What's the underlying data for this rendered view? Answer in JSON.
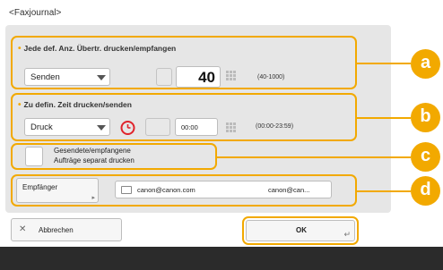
{
  "screen_title": "<Faxjournal>",
  "section_a": {
    "label": "Jede def. Anz. Übertr. drucken/empfangen",
    "dropdown_value": "Senden",
    "count_value": "40",
    "range_hint": "(40-1000)"
  },
  "section_b": {
    "label": "Zu defin. Zeit drucken/senden",
    "dropdown_value": "Druck",
    "time_value": "00:00",
    "range_hint": "(00:00-23:59)"
  },
  "section_c": {
    "checkbox_label_line1": "Gesendete/empfangene",
    "checkbox_label_line2": "Aufträge separat drucken"
  },
  "section_d": {
    "recipient_button": "Empfänger",
    "recipient_address": "canon@canon.com",
    "recipient_address_truncated": "canon@can..."
  },
  "badges": {
    "a": "a",
    "b": "b",
    "c": "c",
    "d": "d"
  },
  "footer": {
    "cancel_label": "Abbrechen",
    "ok_label": "OK"
  },
  "colors": {
    "highlight": "#f2a900",
    "alarm_icon": "#e0242c"
  }
}
